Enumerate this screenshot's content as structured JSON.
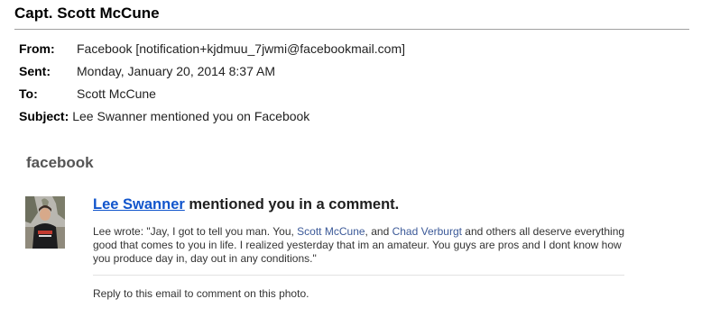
{
  "email": {
    "sender_name": "Capt. Scott McCune",
    "from_label": "From:",
    "from_value": "Facebook [notification+kjdmuu_7jwmi@facebookmail.com]",
    "sent_label": "Sent:",
    "sent_value": "Monday, January 20, 2014 8:37 AM",
    "to_label": "To:",
    "to_value": "Scott McCune",
    "subject_label": "Subject:",
    "subject_value": "Lee Swanner mentioned you on Facebook"
  },
  "notification": {
    "brand": "facebook",
    "actor_name": "Lee Swanner",
    "title_rest": " mentioned you in a comment.",
    "comment_prefix": "Lee wrote: \"Jay, I got to tell you man. You, ",
    "mention_1": "Scott McCune",
    "comment_middle": ", and ",
    "mention_2": "Chad Verburgt",
    "comment_suffix": " and others all deserve everything good that comes to you in life. I realized yesterday that im an amateur. You guys are pros and I dont know how you produce day in, day out in any conditions.\"",
    "reply_hint": "Reply to this email to comment on this photo."
  }
}
